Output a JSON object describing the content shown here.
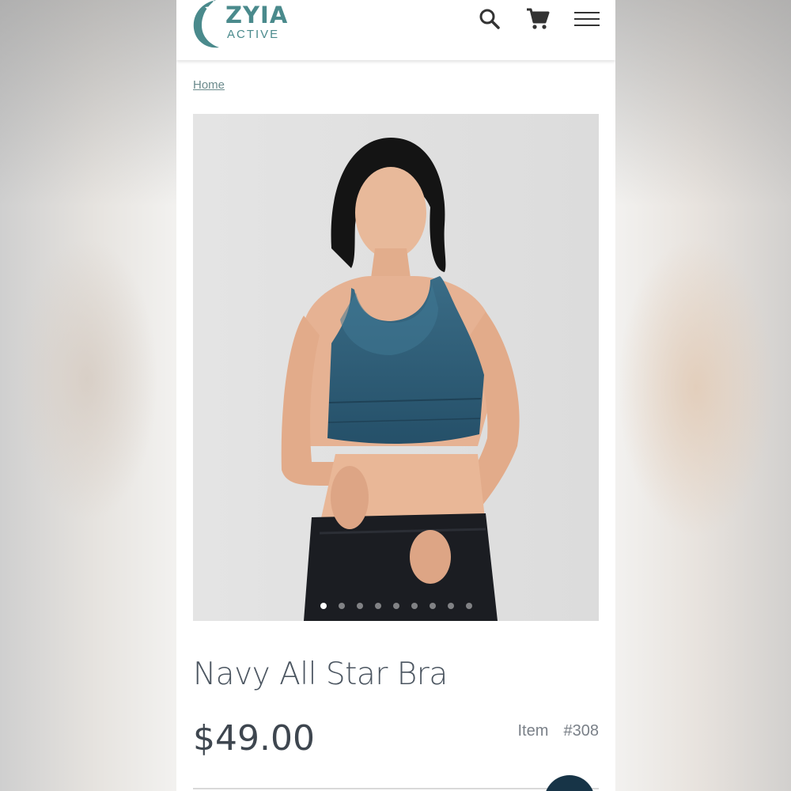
{
  "brand": {
    "name": "ZYIA",
    "tagline": "ACTIVE",
    "color": "#4a8a8c"
  },
  "header": {
    "icons": [
      "search-icon",
      "cart-icon",
      "menu-icon"
    ]
  },
  "breadcrumb": {
    "home": "Home"
  },
  "gallery": {
    "image_count": 9,
    "active_index": 0
  },
  "product": {
    "title": "Navy All Star Bra",
    "price": "$49.00",
    "item_label": "Item",
    "item_number": "#308"
  },
  "colors": {
    "accent_dark": "#173447",
    "bra_blue": "#2f5f78"
  }
}
